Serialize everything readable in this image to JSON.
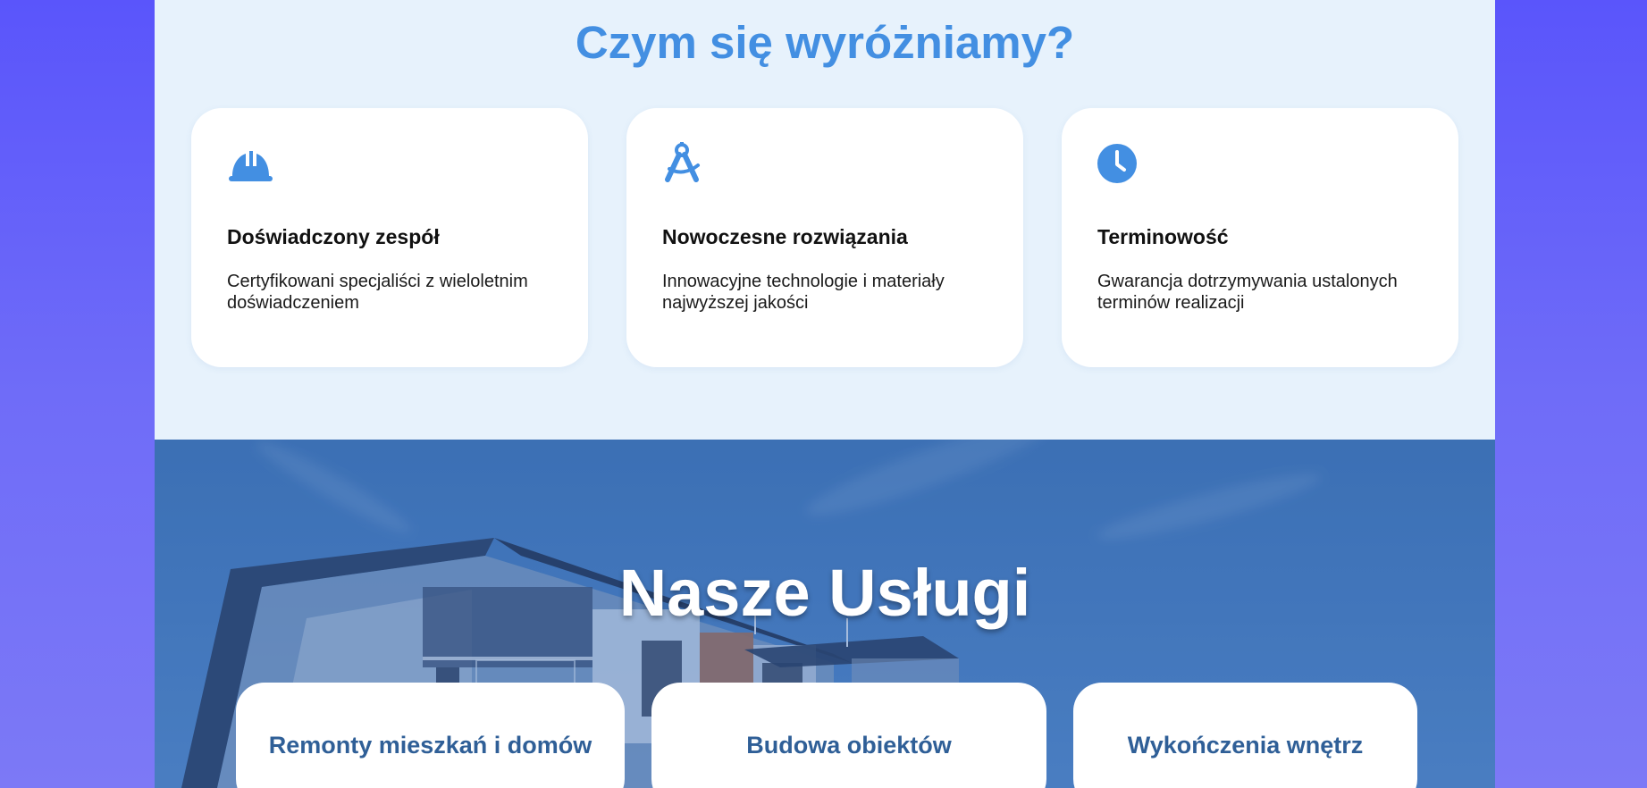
{
  "features": {
    "title": "Czym się wyróżniamy?",
    "accent_color": "#438fe2",
    "cards": [
      {
        "icon": "hard-hat-icon",
        "title": "Doświadczony zespół",
        "text": "Certyfikowani specjaliści z wieloletnim doświadczeniem"
      },
      {
        "icon": "compass-drafting-icon",
        "title": "Nowoczesne rozwiązania",
        "text": "Innowacyjne technologie i materiały najwyższej jakości"
      },
      {
        "icon": "clock-icon",
        "title": "Terminowość",
        "text": "Gwarancja dotrzymywania ustalonych terminów realizacji"
      }
    ]
  },
  "services": {
    "title": "Nasze Usługi",
    "cards": [
      {
        "title": "Remonty mieszkań i domów"
      },
      {
        "title": "Budowa obiektów"
      },
      {
        "title": "Wykończenia wnętrz"
      }
    ]
  }
}
